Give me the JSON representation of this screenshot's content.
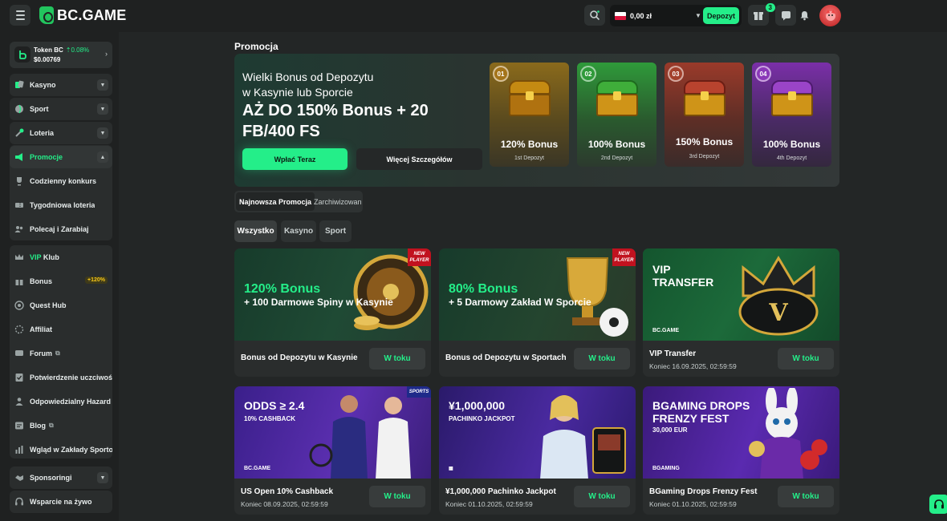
{
  "header": {
    "brand": "BC.GAME",
    "balance": "0,00 zł",
    "deposit_label": "Depozyt",
    "rewards_badge": "3"
  },
  "sidebar": {
    "token": {
      "name": "Token BC",
      "change": "0.08%",
      "price": "$0.00769"
    },
    "items": [
      {
        "label": "Kasyno"
      },
      {
        "label": "Sport"
      },
      {
        "label": "Loteria"
      },
      {
        "label": "Promocje"
      },
      {
        "label": "Codzienny konkurs"
      },
      {
        "label": "Tygodniowa loteria"
      },
      {
        "label": "Polecaj i Zarabiaj"
      },
      {
        "label_prefix": "VIP",
        "label": "Klub"
      },
      {
        "label": "Bonus",
        "badge": "+120%"
      },
      {
        "label": "Quest Hub"
      },
      {
        "label": "Affiliat"
      },
      {
        "label": "Forum"
      },
      {
        "label": "Potwierdzenie uczciwości"
      },
      {
        "label": "Odpowiedzialny Hazard"
      },
      {
        "label": "Blog"
      },
      {
        "label": "Wgląd w Zakłady Sportowe"
      },
      {
        "label": "Sponsoringi"
      },
      {
        "label": "Wsparcie na żywo"
      }
    ]
  },
  "main": {
    "title": "Promocja",
    "hero": {
      "subtitle_line1": "Wielki Bonus od Depozytu",
      "subtitle_line2": "w Kasynie lub Sporcie",
      "headline": "AŻ DO 150% Bonus + 20 FB/400 FS",
      "primary_button": "Wpłać Teraz",
      "secondary_button": "Więcej Szczegółów",
      "tiers": [
        {
          "num": "01",
          "title": "120% Bonus",
          "sub": "1st Depozyt"
        },
        {
          "num": "02",
          "title": "100% Bonus",
          "sub": "2nd Depozyt"
        },
        {
          "num": "03",
          "title": "150% Bonus",
          "sub": "3rd Depozyt"
        },
        {
          "num": "04",
          "title": "100% Bonus",
          "sub": "4th Depozyt"
        }
      ]
    },
    "segment": {
      "active": "Najnowsza Promocja",
      "other": "Zarchiwizowan"
    },
    "filters": [
      "Wszystko",
      "Kasyno",
      "Sport"
    ],
    "cards": [
      {
        "img_line1": "120% Bonus",
        "img_line2": "+ 100 Darmowe Spiny w Kasynie",
        "tag": "NEW PLAYER",
        "title": "Bonus od Depozytu w Kasynie",
        "date": "",
        "status": "W toku"
      },
      {
        "img_line1": "80% Bonus",
        "img_line2": "+ 5 Darmowy Zakład W Sporcie",
        "tag": "NEW PLAYER",
        "title": "Bonus od Depozytu w Sportach",
        "date": "",
        "status": "W toku"
      },
      {
        "img_line1": "VIP",
        "img_line2": "TRANSFER",
        "brand": "BC.GAME",
        "title": "VIP Transfer",
        "date": "Koniec 16.09.2025, 02:59:59",
        "status": "W toku"
      },
      {
        "img_line1": "ODDS ≥ 2.4",
        "img_line2": "10% CASHBACK",
        "tag": "SPORTS",
        "brand": "BC.GAME",
        "title": "US Open 10% Cashback",
        "date": "Koniec 08.09.2025, 02:59:59",
        "status": "W toku"
      },
      {
        "img_line1": "¥1,000,000",
        "img_line2": "PACHINKO JACKPOT",
        "title": "¥1,000,000 Pachinko Jackpot",
        "date": "Koniec 01.10.2025, 02:59:59",
        "status": "W toku"
      },
      {
        "img_line1": "BGAMING DROPS",
        "img_line1b": "FRENZY FEST",
        "img_line2": "30,000 EUR",
        "brand": "BGAMING",
        "title": "BGaming Drops Frenzy Fest",
        "date": "Koniec 01.10.2025, 02:59:59",
        "status": "W toku"
      }
    ]
  },
  "colors": {
    "accent": "#24ee89",
    "bg": "#232626",
    "panel": "#2a2d2d"
  }
}
